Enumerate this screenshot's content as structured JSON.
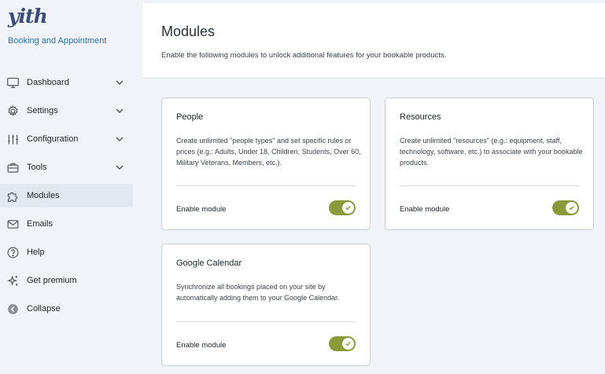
{
  "brand": {
    "logo_text": "yith",
    "product_name": "Booking and Appointment"
  },
  "sidebar": {
    "items": [
      {
        "label": "Dashboard",
        "icon": "monitor-icon",
        "has_submenu": true
      },
      {
        "label": "Settings",
        "icon": "gear-icon",
        "has_submenu": true
      },
      {
        "label": "Configuration",
        "icon": "sliders-icon",
        "has_submenu": true
      },
      {
        "label": "Tools",
        "icon": "toolbox-icon",
        "has_submenu": true
      },
      {
        "label": "Modules",
        "icon": "puzzle-icon",
        "active": true
      },
      {
        "label": "Emails",
        "icon": "envelope-icon"
      },
      {
        "label": "Help",
        "icon": "help-circle-icon"
      },
      {
        "label": "Get premium",
        "icon": "sparkle-icon"
      },
      {
        "label": "Collapse",
        "icon": "collapse-arrow-icon"
      }
    ]
  },
  "page": {
    "title": "Modules",
    "description": "Enable the following modules to unlock additional features for your bookable products."
  },
  "modules": [
    {
      "title": "People",
      "description": "Create unlimited \"people types\" and set specific rules or prices (e.g.: Adults, Under 18, Children, Students, Over 60, Military Veterans, Members, etc.).",
      "enable_label": "Enable module",
      "enabled": true
    },
    {
      "title": "Resources",
      "description": "Create unlimited \"resources\" (e.g.: equipment, staff, technology, software, etc.) to associate with your bookable products.",
      "enable_label": "Enable module",
      "enabled": true
    },
    {
      "title": "Google Calendar",
      "description": "Synchronize all bookings placed on your site by automatically adding them to your Google Calendar.",
      "enable_label": "Enable module",
      "enabled": true
    }
  ],
  "colors": {
    "toggle_on": "#8a9a3b",
    "accent_blue": "#2f6fa6",
    "active_bg": "#e3e7ee"
  }
}
